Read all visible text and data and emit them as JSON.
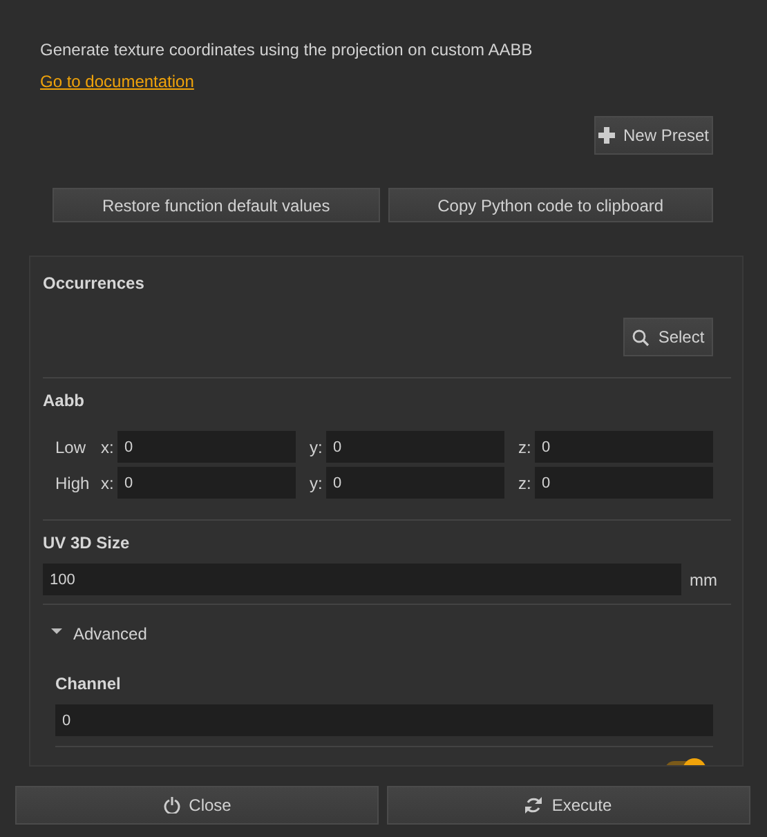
{
  "description": "Generate texture coordinates using the projection on custom AABB",
  "doc_link": "Go to documentation",
  "new_preset_button": "New Preset",
  "action_buttons": [
    "Restore function default values",
    "Copy Python code to clipboard"
  ],
  "occurrences": {
    "title": "Occurrences",
    "select_button": "Select"
  },
  "aabb": {
    "title": "Aabb",
    "rows": [
      {
        "label": "Low",
        "fields": [
          {
            "axis": "x:",
            "value": "0"
          },
          {
            "axis": "y:",
            "value": "0"
          },
          {
            "axis": "z:",
            "value": "0"
          }
        ]
      },
      {
        "label": "High",
        "fields": [
          {
            "axis": "x:",
            "value": "0"
          },
          {
            "axis": "y:",
            "value": "0"
          },
          {
            "axis": "z:",
            "value": "0"
          }
        ]
      }
    ]
  },
  "uv_size": {
    "title": "UV 3D Size",
    "value": "100",
    "unit": "mm"
  },
  "advanced": {
    "label": "Advanced",
    "expanded": true,
    "channel": {
      "title": "Channel",
      "value": "0"
    },
    "toggle": {
      "on": true
    }
  },
  "footer_buttons": [
    {
      "kind": "close",
      "label": "Close"
    },
    {
      "kind": "execute",
      "label": "Execute"
    }
  ]
}
